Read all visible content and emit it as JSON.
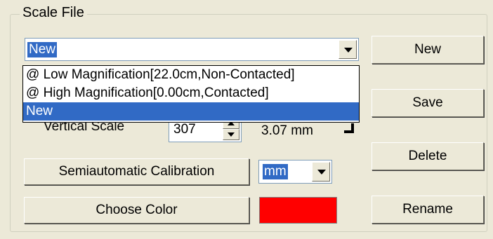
{
  "group": {
    "title": "Scale File"
  },
  "scale_combo": {
    "value": "New"
  },
  "dropdown_list": [
    "@ Low Magnification[22.0cm,Non-Contacted]",
    "@ High Magnification[0.00cm,Contacted]",
    "New"
  ],
  "vertical": {
    "label": "Vertical Scale",
    "value": "307",
    "mm_text": "3.07 mm"
  },
  "buttons": {
    "new": "New",
    "save": "Save",
    "delete": "Delete",
    "rename": "Rename",
    "semiauto": "Semiautomatic Calibration",
    "choose_color": "Choose Color"
  },
  "unit": {
    "value": "mm"
  },
  "colors": {
    "selected_color": "#ff0000",
    "highlight": "#316ac5",
    "face": "#ece9d8"
  }
}
